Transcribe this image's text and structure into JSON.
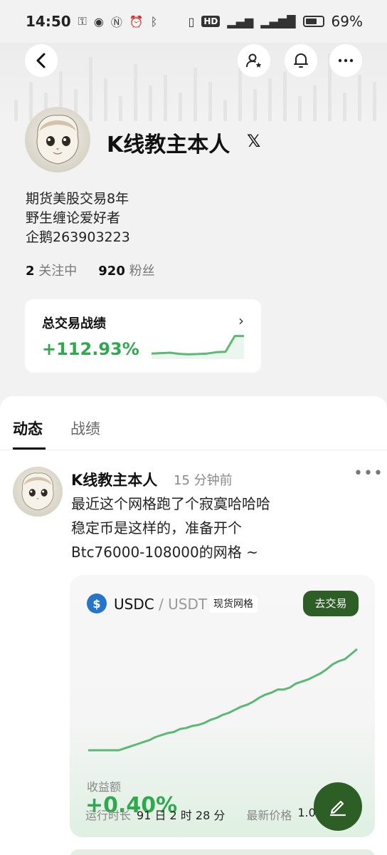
{
  "status_bar": {
    "time": "14:50",
    "battery_percent": "69%",
    "battery_level": 0.69,
    "left_icons": [
      "key-icon",
      "eye-icon",
      "nfc-icon",
      "alarm-icon",
      "bluetooth-icon"
    ],
    "right_icons": [
      "vibrate-icon",
      "hd-icon",
      "signal-icon",
      "4g-signal-icon",
      "battery-icon"
    ]
  },
  "header": {
    "back_icon": "back-icon",
    "follow_icon": "follow-user-icon",
    "bell_icon": "bell-icon",
    "more_icon": "more-icon"
  },
  "profile": {
    "name": "K线教主本人",
    "x_badge": "𝕏",
    "bio": [
      "期货美股交易8年",
      "野生缠论爱好者",
      "企鹅263903223"
    ],
    "following_count": "2",
    "following_label": "关注中",
    "followers_count": "920",
    "followers_label": "粉丝"
  },
  "performance": {
    "title": "总交易战绩",
    "value": "+112.93%",
    "chevron": "›",
    "sparkline": [
      0.18,
      0.2,
      0.22,
      0.17,
      0.15,
      0.16,
      0.18,
      0.24,
      0.26,
      0.95,
      0.95
    ]
  },
  "tabs": [
    {
      "label": "动态",
      "active": true
    },
    {
      "label": "战绩",
      "active": false
    }
  ],
  "post": {
    "author": "K线教主本人",
    "time": "15 分钟前",
    "more": "•••",
    "lines": [
      "最近这个网格跑了个寂寞哈哈哈",
      "稳定币是这样的，准备开个",
      "Btc76000-108000的网格 ~"
    ],
    "card": {
      "coin_symbol": "$",
      "base": "USDC",
      "separator": "/",
      "quote": "USDT",
      "tag": "现货网格",
      "trade_button": "去交易",
      "profit_label": "收益额",
      "profit_value": "+0.40%",
      "runtime_label": "运行时长",
      "runtime_value": "91 日 2 时 28 分",
      "price_label": "最新价格",
      "price_value": "1.0",
      "chart_series": [
        0,
        0,
        0,
        0,
        0,
        0,
        0.02,
        0.04,
        0.06,
        0.08,
        0.1,
        0.13,
        0.15,
        0.17,
        0.18,
        0.21,
        0.22,
        0.24,
        0.25,
        0.27,
        0.3,
        0.32,
        0.35,
        0.37,
        0.4,
        0.43,
        0.45,
        0.48,
        0.52,
        0.55,
        0.57,
        0.6,
        0.6,
        0.62,
        0.66,
        0.68,
        0.7,
        0.73,
        0.76,
        0.8,
        0.85,
        0.88,
        0.9,
        0.95,
        1.0
      ]
    }
  },
  "colors": {
    "accent_green": "#2fa84f",
    "button_green": "#2d5e26",
    "usdc_blue": "#2775ca"
  },
  "fab_icon": "edit-icon"
}
